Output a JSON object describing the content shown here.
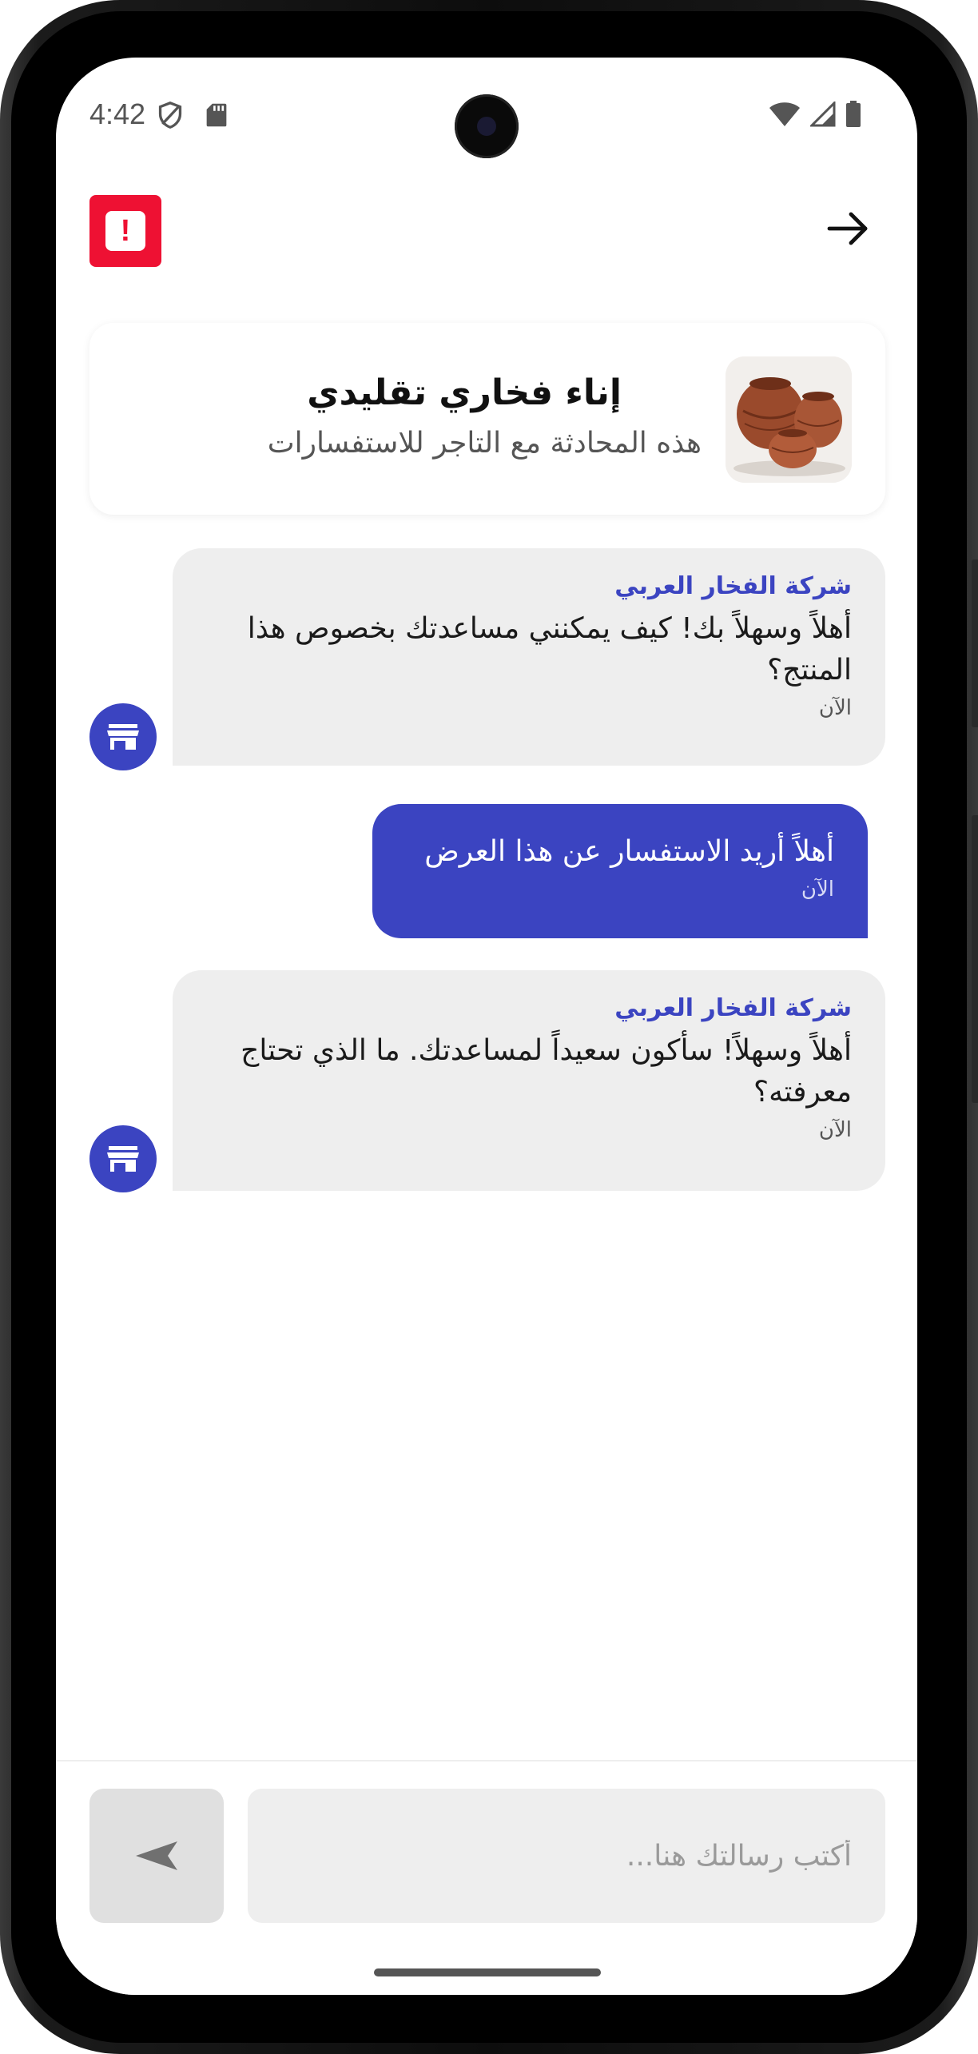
{
  "status_bar": {
    "time": "4:42"
  },
  "header": {
    "report_icon_glyph": "!",
    "back_icon": "arrow-right-icon"
  },
  "product": {
    "title": "إناء فخاري تقليدي",
    "subtitle": "هذه المحادثة مع التاجر للاستفسارات"
  },
  "messages": [
    {
      "direction": "incoming",
      "sender": "شركة الفخار العربي",
      "text": "أهلاً وسهلاً بك! كيف يمكنني مساعدتك بخصوص هذا المنتج؟",
      "time": "الآن"
    },
    {
      "direction": "outgoing",
      "text": "أهلاً أريد الاستفسار عن هذا العرض",
      "time": "الآن"
    },
    {
      "direction": "incoming",
      "sender": "شركة الفخار العربي",
      "text": "أهلاً وسهلاً! سأكون سعيداً لمساعدتك. ما الذي تحتاج معرفته؟",
      "time": "الآن"
    }
  ],
  "composer": {
    "placeholder": "أكتب رسالتك هنا..."
  },
  "colors": {
    "accent": "#3b44c1",
    "report": "#ee1133",
    "bubble_in": "#eeeeee"
  }
}
